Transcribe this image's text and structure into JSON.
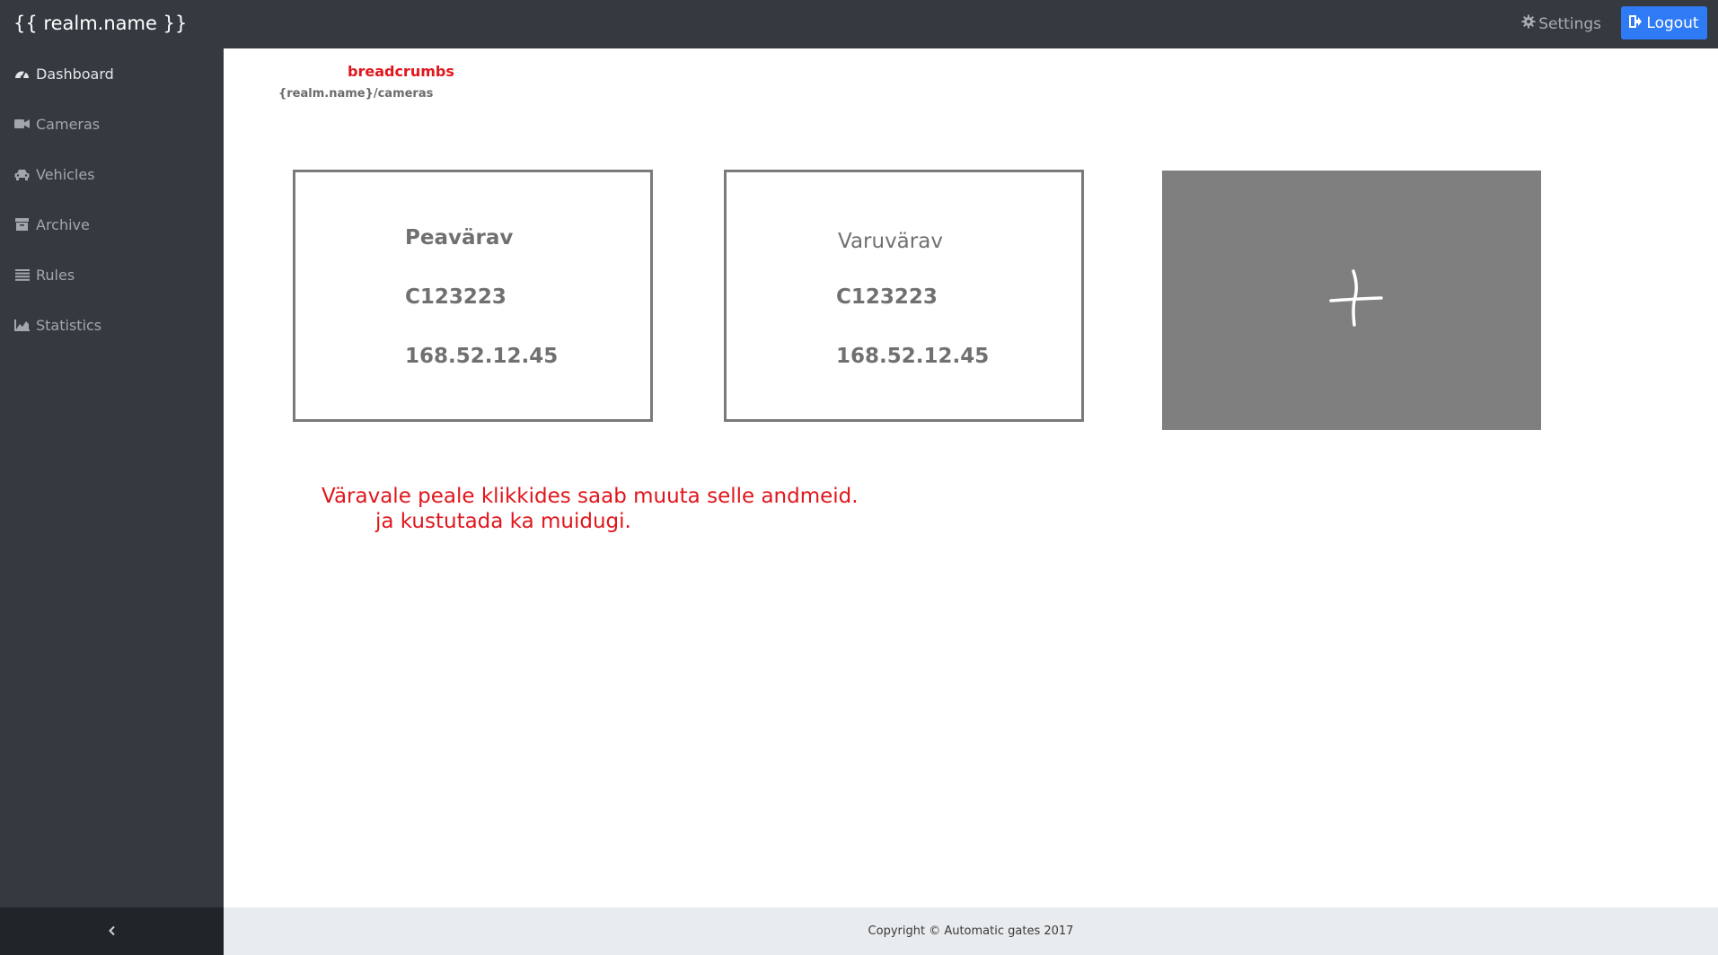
{
  "header": {
    "brand": "{{ realm.name }}",
    "settings_label": "Settings",
    "logout_label": "Logout"
  },
  "sidebar": {
    "items": [
      {
        "label": "Dashboard",
        "icon": "dashboard-icon"
      },
      {
        "label": "Cameras",
        "icon": "camera-icon"
      },
      {
        "label": "Vehicles",
        "icon": "car-icon"
      },
      {
        "label": "Archive",
        "icon": "archive-icon"
      },
      {
        "label": "Rules",
        "icon": "list-icon"
      },
      {
        "label": "Statistics",
        "icon": "chart-icon"
      }
    ],
    "toggle_icon": "chevron-left-icon"
  },
  "breadcrumbs": {
    "note": "breadcrumbs",
    "path": "{realm.name}/cameras"
  },
  "cameras": [
    {
      "name": "Peavärav",
      "id": "C123223",
      "ip": "168.52.12.45"
    },
    {
      "name": "Varuvärav",
      "id": "C123223",
      "ip": "168.52.12.45"
    }
  ],
  "add_card": {
    "icon": "plus-icon"
  },
  "annotation": {
    "line1": "Väravale peale klikkides saab muuta selle andmeid.",
    "line2": "ja kustutada ka muidugi."
  },
  "footer": {
    "copyright": "Copyright © Automatic gates 2017"
  },
  "colors": {
    "topbar": "#343a40",
    "sidebar": "#343a40",
    "logout_button": "#2f7bf5",
    "annotation_red": "#e0161c",
    "footer": "#e9ecef",
    "add_card": "#7f7f7f"
  }
}
